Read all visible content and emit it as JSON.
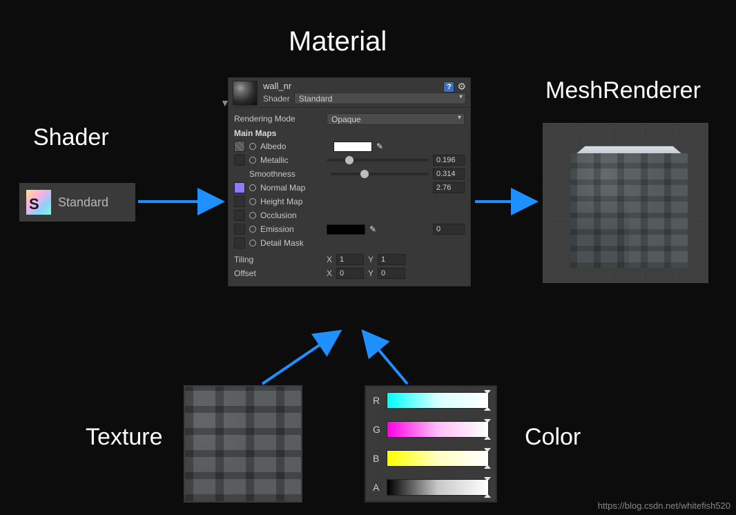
{
  "labels": {
    "material": "Material",
    "shader": "Shader",
    "mesh": "MeshRenderer",
    "texture": "Texture",
    "color": "Color"
  },
  "shader_chip": {
    "icon_letter": "S",
    "name": "Standard"
  },
  "inspector": {
    "name": "wall_nr",
    "shader_label": "Shader",
    "shader_value": "Standard",
    "rendering_mode_label": "Rendering Mode",
    "rendering_mode_value": "Opaque",
    "section": "Main Maps",
    "albedo": "Albedo",
    "metallic": "Metallic",
    "metallic_value": "0.196",
    "smoothness": "Smoothness",
    "smoothness_value": "0.314",
    "normal": "Normal Map",
    "normal_value": "2.76",
    "height": "Height Map",
    "occlusion": "Occlusion",
    "emission": "Emission",
    "emission_value": "0",
    "detail": "Detail Mask",
    "tiling_label": "Tiling",
    "offset_label": "Offset",
    "tiling": {
      "x": "1",
      "y": "1"
    },
    "offset": {
      "x": "0",
      "y": "0"
    }
  },
  "color_channels": {
    "r": "R",
    "g": "G",
    "b": "B",
    "a": "A"
  },
  "watermark": "https://blog.csdn.net/whitefish520",
  "colors": {
    "arrow": "#1e90ff"
  }
}
